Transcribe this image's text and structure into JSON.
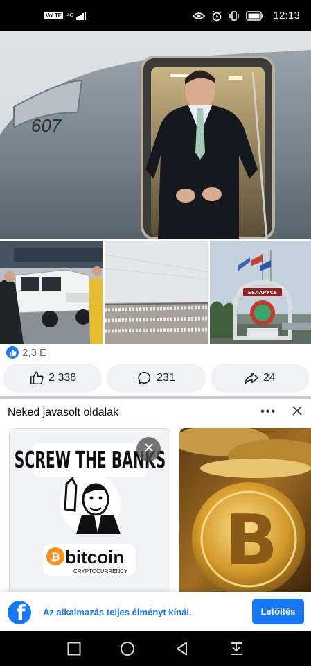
{
  "status_bar": {
    "volte": "VoLTE",
    "network": "4G",
    "time": "12:13",
    "icons": [
      "signal-icon",
      "eye-icon",
      "alarm-icon",
      "vibrate-icon",
      "battery-icon"
    ]
  },
  "post": {
    "photos": [
      {
        "name": "photo-main",
        "aircraft_number": "607"
      },
      {
        "name": "photo-suv"
      },
      {
        "name": "photo-snow-field"
      },
      {
        "name": "photo-border-monument",
        "sign_text": "БЕЛАРУСЬ"
      }
    ],
    "reactions": {
      "icon": "like-icon",
      "count": "2,3 E"
    },
    "actions": {
      "like_count": "2 338",
      "comment_count": "231",
      "share_count": "24"
    }
  },
  "suggested": {
    "title": "Neked javasolt oldalak",
    "more_label": "•••",
    "cards": [
      {
        "headline": "SCREW THE BANKS",
        "brand": "bitcoin",
        "brand_sub": "CRYPTOCURRENCY",
        "coin_symbol": "₿"
      },
      {
        "coin_symbol": "B"
      }
    ]
  },
  "app_banner": {
    "logo": "f",
    "text": "Az alkalmazás teljes élményt kínál.",
    "button": "Letöltés"
  },
  "nav_bar": {
    "icons": [
      "recent-apps-icon",
      "home-icon",
      "back-icon",
      "notification-pull-icon"
    ]
  },
  "colors": {
    "accent": "#1877f2",
    "action_bg": "#eff1f4",
    "muted_text": "#65676b"
  }
}
